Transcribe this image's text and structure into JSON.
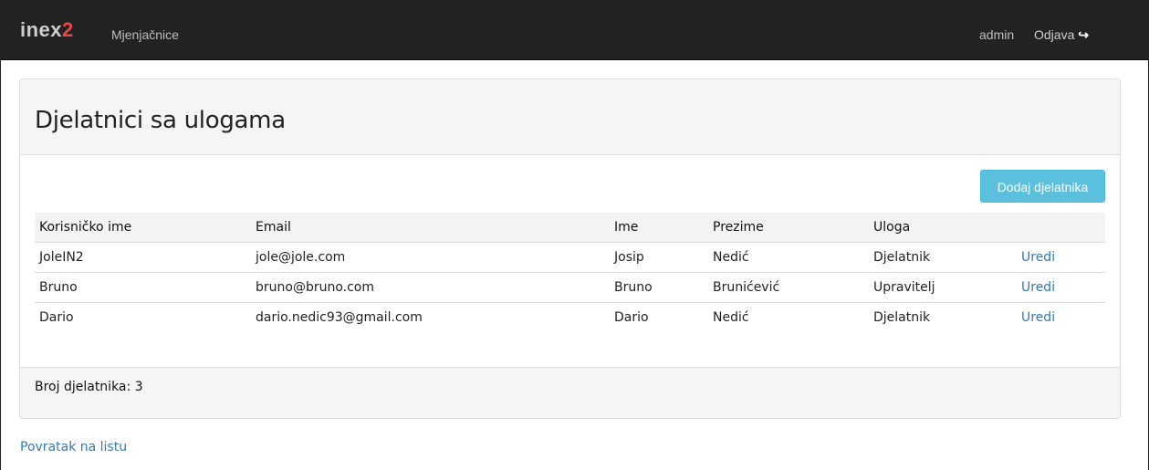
{
  "navbar": {
    "brand_text": "inex",
    "brand_accent": "2",
    "exchange_link": "Mjenjačnice",
    "username": "admin",
    "logout_label": "Odjava",
    "logout_icon": "sign-out-icon",
    "background_color": "#222222",
    "brand_accent_color": "#e84848"
  },
  "panel": {
    "title": "Djelatnici sa ulogama",
    "add_button_label": "Dodaj djelatnika",
    "add_button_color": "#5bc0de",
    "table": {
      "headers": [
        "Korisničko ime",
        "Email",
        "Ime",
        "Prezime",
        "Uloga",
        ""
      ],
      "rows": [
        {
          "username": "JoleIN2",
          "email": "jole@jole.com",
          "first_name": "Josip",
          "last_name": "Nedić",
          "role": "Djelatnik",
          "action": "Uredi"
        },
        {
          "username": "Bruno",
          "email": "bruno@bruno.com",
          "first_name": "Bruno",
          "last_name": "Brunićević",
          "role": "Upravitelj",
          "action": "Uredi"
        },
        {
          "username": "Dario",
          "email": "dario.nedic93@gmail.com",
          "first_name": "Dario",
          "last_name": "Nedić",
          "role": "Djelatnik",
          "action": "Uredi"
        }
      ]
    },
    "footer": {
      "count_label": "Broj djelatnika:",
      "count_value": "3"
    }
  },
  "back_link": "Povratak na listu",
  "link_color": "#337ab7"
}
